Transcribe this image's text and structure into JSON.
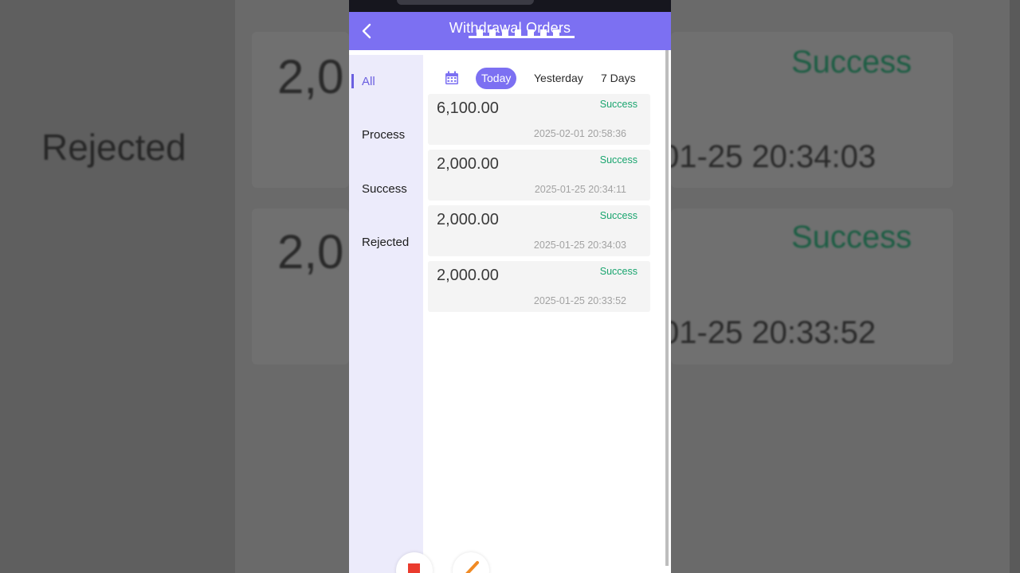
{
  "app": {
    "title": "Withdrawal Orders"
  },
  "sidebar": {
    "items": [
      {
        "label": "All",
        "active": true
      },
      {
        "label": "Process",
        "active": false
      },
      {
        "label": "Success",
        "active": false
      },
      {
        "label": "Rejected",
        "active": false
      }
    ]
  },
  "filters": {
    "items": [
      {
        "label": "Today",
        "active": true
      },
      {
        "label": "Yesterday",
        "active": false
      },
      {
        "label": "7 Days",
        "active": false
      }
    ]
  },
  "orders": [
    {
      "amount": "6,100.00",
      "status": "Success",
      "time": "2025-02-01 20:58:36"
    },
    {
      "amount": "2,000.00",
      "status": "Success",
      "time": "2025-01-25 20:34:11"
    },
    {
      "amount": "2,000.00",
      "status": "Success",
      "time": "2025-01-25 20:34:03"
    },
    {
      "amount": "2,000.00",
      "status": "Success",
      "time": "2025-01-25 20:33:52"
    }
  ],
  "background": {
    "left_text": "Rejected",
    "amount_top": "2,0",
    "amount_bottom": "2,0",
    "status_top": "Success",
    "status_bottom": "Success",
    "time_top": "01-25 20:34:03",
    "time_bottom": "01-25 20:33:52"
  },
  "colors": {
    "accent": "#7c70f2",
    "success": "#1aa56f",
    "sidebar_bg": "#ecebfb"
  }
}
